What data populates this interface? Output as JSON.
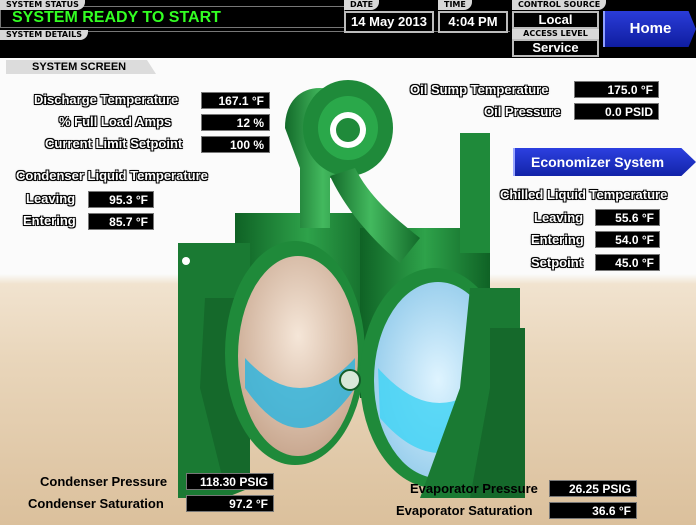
{
  "header": {
    "system_status_tag": "SYSTEM STATUS",
    "system_status": "SYSTEM READY TO START",
    "system_details_tag": "SYSTEM DETAILS",
    "date_tag": "DATE",
    "date": "14 May 2013",
    "time_tag": "TIME",
    "time": "4:04 PM",
    "control_source_tag": "CONTROL SOURCE",
    "control_source": "Local",
    "access_level_tag": "ACCESS LEVEL",
    "access_level": "Service",
    "home_button": "Home"
  },
  "screen": {
    "tab_label": "SYSTEM SCREEN",
    "economizer_button": "Economizer System",
    "discharge": {
      "label": "Discharge Temperature",
      "value": "167.1 °F"
    },
    "full_load_amps": {
      "label": "% Full Load Amps",
      "value": "12 %"
    },
    "current_limit": {
      "label": "Current Limit Setpoint",
      "value": "100 %"
    },
    "condenser_liquid": {
      "title": "Condenser Liquid Temperature",
      "leaving_label": "Leaving",
      "leaving_value": "95.3 °F",
      "entering_label": "Entering",
      "entering_value": "85.7 °F"
    },
    "oil_sump": {
      "label": "Oil Sump Temperature",
      "value": "175.0 °F"
    },
    "oil_pressure": {
      "label": "Oil Pressure",
      "value": "0.0 PSID"
    },
    "chilled_liquid": {
      "title": "Chilled Liquid Temperature",
      "leaving_label": "Leaving",
      "leaving_value": "55.6 °F",
      "entering_label": "Entering",
      "entering_value": "54.0 °F",
      "setpoint_label": "Setpoint",
      "setpoint_value": "45.0 °F"
    },
    "condenser_pressure": {
      "label": "Condenser Pressure",
      "value": "118.30 PSIG"
    },
    "condenser_saturation": {
      "label": "Condenser Saturation",
      "value": "97.2 °F"
    },
    "evaporator_pressure": {
      "label": "Evaporator Pressure",
      "value": "26.25 PSIG"
    },
    "evaporator_saturation": {
      "label": "Evaporator Saturation",
      "value": "36.6 °F"
    }
  },
  "colors": {
    "status_green": "#32ff22",
    "machine_green": "#1f8a3a",
    "button_blue": "#1f30c8"
  }
}
